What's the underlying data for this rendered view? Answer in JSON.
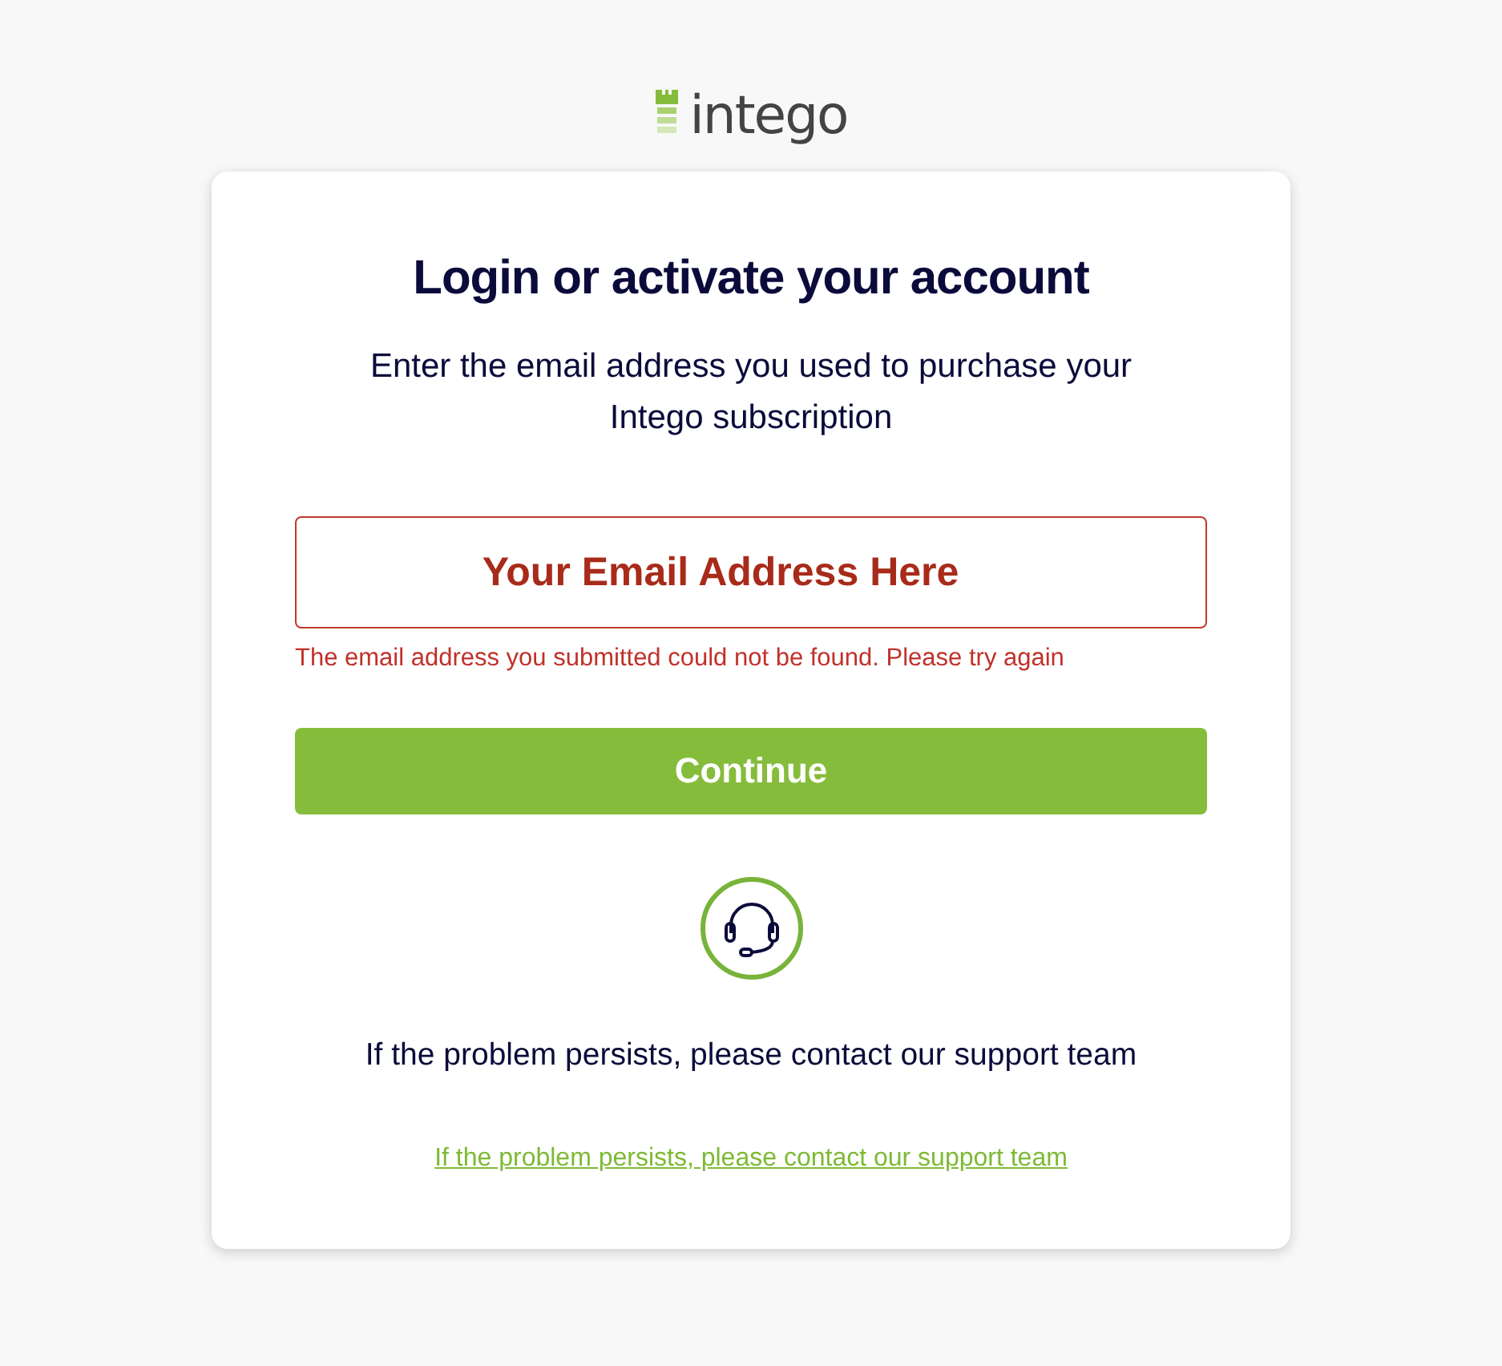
{
  "logo": {
    "text": "intego"
  },
  "card": {
    "title": "Login or activate your account",
    "subtitle": "Enter the email address you used to purchase your Intego subscription",
    "email_field": {
      "placeholder": "Your Email Address Here",
      "error": true
    },
    "error_message": "The email address you submitted could not be found. Please try again",
    "continue_button": "Continue",
    "support_text": "If the problem persists, please contact our support team",
    "support_link": "If the problem persists, please contact our support team"
  }
}
